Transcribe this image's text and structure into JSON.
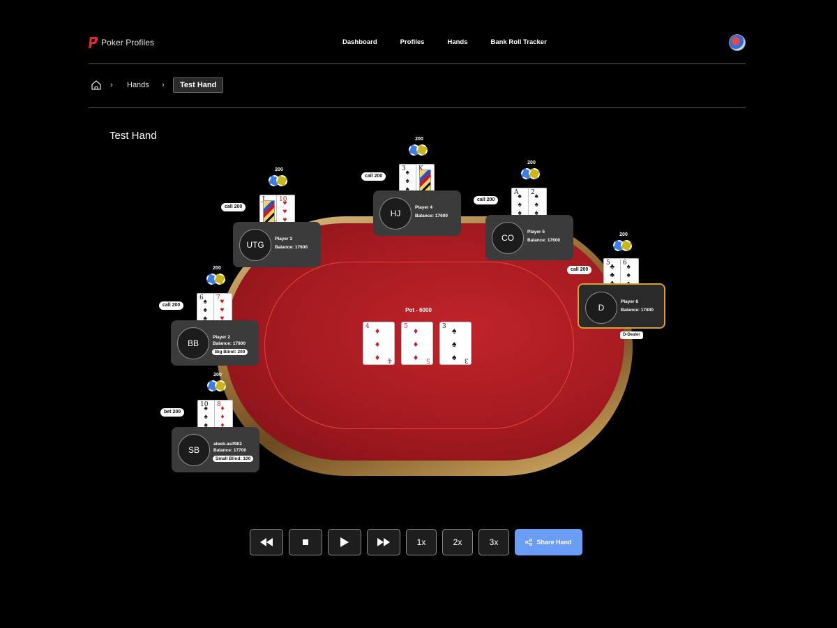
{
  "header": {
    "logo_text": "Poker Profiles",
    "nav": [
      "Dashboard",
      "Profiles",
      "Hands",
      "Bank Roll Tracker"
    ]
  },
  "breadcrumb": {
    "link": "Hands",
    "current": "Test Hand"
  },
  "page_title": "Test Hand",
  "table": {
    "pot_label": "Pot - 6000",
    "dealer_tag": "D-Dealer",
    "board": [
      {
        "rank": "4",
        "suit": "♦",
        "color": "red"
      },
      {
        "rank": "5",
        "suit": "♦",
        "color": "red"
      },
      {
        "rank": "3",
        "suit": "♠",
        "color": "black"
      }
    ]
  },
  "seats": [
    {
      "pos": "UTG",
      "name": "Player 3",
      "balance": "Balance: 17600",
      "action": "call 200",
      "bet": "200",
      "cards": [
        {
          "rank": "J",
          "suit": "♣",
          "color": "black",
          "face": true
        },
        {
          "rank": "10",
          "suit": "♥",
          "color": "red"
        }
      ]
    },
    {
      "pos": "HJ",
      "name": "Player 4",
      "balance": "Balance: 17600",
      "action": "call 200",
      "bet": "200",
      "cards": [
        {
          "rank": "3",
          "suit": "♠",
          "color": "black"
        },
        {
          "rank": "K",
          "suit": "♠",
          "color": "black",
          "face": true
        }
      ]
    },
    {
      "pos": "CO",
      "name": "Player 5",
      "balance": "Balance: 17600",
      "action": "call 200",
      "bet": "200",
      "cards": [
        {
          "rank": "A",
          "suit": "♠",
          "color": "black"
        },
        {
          "rank": "2",
          "suit": "♠",
          "color": "black"
        }
      ]
    },
    {
      "pos": "D",
      "name": "Player 6",
      "balance": "Balance: 17800",
      "action": "call 200",
      "bet": "200",
      "cards": [
        {
          "rank": "5",
          "suit": "♣",
          "color": "black"
        },
        {
          "rank": "6",
          "suit": "♠",
          "color": "black"
        }
      ]
    },
    {
      "pos": "BB",
      "name": "Player 2",
      "balance": "Balance: 17800",
      "blind": "Big Blind: 200",
      "action": "call 200",
      "bet": "200",
      "cards": [
        {
          "rank": "6",
          "suit": "♠",
          "color": "black"
        },
        {
          "rank": "7",
          "suit": "♥",
          "color": "red"
        }
      ]
    },
    {
      "pos": "SB",
      "name": "ateeb.asif902",
      "balance": "Balance: 17700",
      "blind": "Small Blind: 100",
      "action": "bet 200",
      "bet": "200",
      "cards": [
        {
          "rank": "10",
          "suit": "♠",
          "color": "black"
        },
        {
          "rank": "8",
          "suit": "♦",
          "color": "red"
        }
      ]
    }
  ],
  "controls": {
    "speeds": [
      "1x",
      "2x",
      "3x"
    ],
    "share_label": "Share Hand"
  },
  "colors": {
    "felt": "#a31a20",
    "rim": "#b38a4a",
    "share_button": "#6a9ef5",
    "active_seat_border": "#d7a12b"
  }
}
